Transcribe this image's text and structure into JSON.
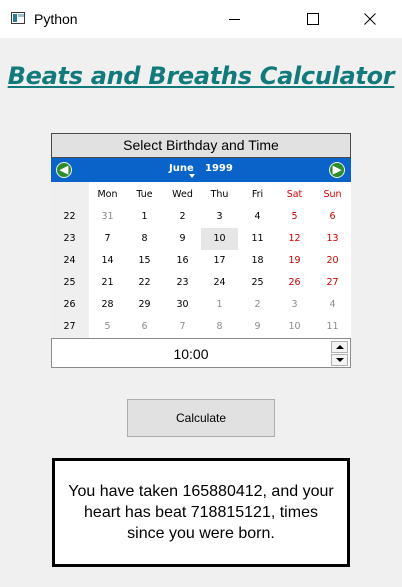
{
  "window": {
    "title": "Python"
  },
  "heading": "Beats and Breaths Calculator",
  "calendar": {
    "header_label": "Select Birthday and Time",
    "month": "June",
    "year": "1999",
    "weekdays": [
      "Mon",
      "Tue",
      "Wed",
      "Thu",
      "Fri",
      "Sat",
      "Sun"
    ],
    "week_numbers": [
      "22",
      "23",
      "24",
      "25",
      "26",
      "27"
    ],
    "days": [
      [
        "31",
        "1",
        "2",
        "3",
        "4",
        "5",
        "6"
      ],
      [
        "7",
        "8",
        "9",
        "10",
        "11",
        "12",
        "13"
      ],
      [
        "14",
        "15",
        "16",
        "17",
        "18",
        "19",
        "20"
      ],
      [
        "21",
        "22",
        "23",
        "24",
        "25",
        "26",
        "27"
      ],
      [
        "28",
        "29",
        "30",
        "1",
        "2",
        "3",
        "4"
      ],
      [
        "5",
        "6",
        "7",
        "8",
        "9",
        "10",
        "11"
      ]
    ],
    "selected_day": "10",
    "weekend_color": "#d00000",
    "nav_color": "#0a63c9"
  },
  "time": {
    "value": "10:00"
  },
  "calculate_label": "Calculate",
  "result": "You have taken 165880412, and your heart has beat 718815121, times since you were born.",
  "colors": {
    "heading": "#127a7a",
    "background": "#f0f0f0"
  }
}
